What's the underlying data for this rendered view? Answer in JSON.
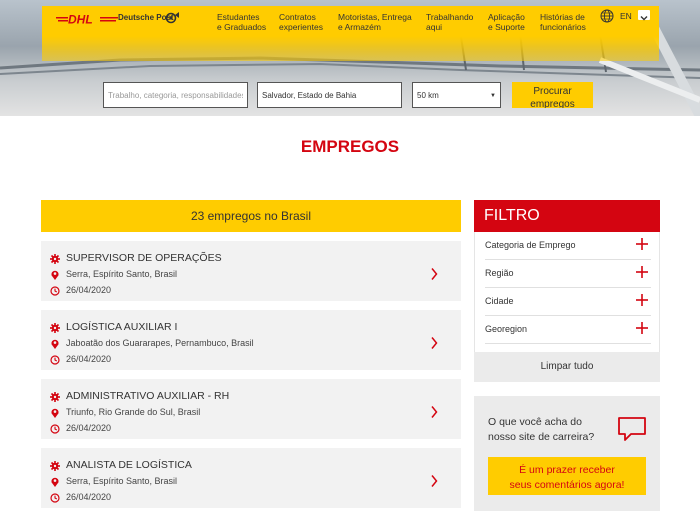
{
  "brand": {
    "logo_text": "DHL",
    "partner": "Deutsche Post"
  },
  "nav": {
    "items": [
      {
        "lines": [
          "Estudantes",
          "e Graduados"
        ]
      },
      {
        "lines": [
          "Contratos",
          "experientes"
        ]
      },
      {
        "lines": [
          "Motoristas, Entrega",
          "e Armazém"
        ]
      },
      {
        "lines": [
          "Trabalhando",
          "aqui"
        ]
      },
      {
        "lines": [
          "Aplicação",
          "e Suporte"
        ]
      },
      {
        "lines": [
          "Histórias de",
          "funcionários"
        ]
      }
    ],
    "language": "EN"
  },
  "search": {
    "keyword_placeholder": "Trabalho, categoria, responsabilidades",
    "location_value": "Salvador, Estado de Bahia",
    "radius": "50 km",
    "button_label": "Procurar empregos"
  },
  "page": {
    "title": "EMPREGOS"
  },
  "results": {
    "summary": "23 empregos no Brasil",
    "jobs": [
      {
        "title": "SUPERVISOR DE OPERAÇÕES",
        "location": "Serra, Espírito Santo, Brasil",
        "date": "26/04/2020"
      },
      {
        "title": "LOGÍSTICA AUXILIAR I",
        "location": "Jaboatão dos Guararapes, Pernambuco, Brasil",
        "date": "26/04/2020"
      },
      {
        "title": "ADMINISTRATIVO AUXILIAR - RH",
        "location": "Triunfo, Rio Grande do Sul, Brasil",
        "date": "26/04/2020"
      },
      {
        "title": "ANALISTA DE LOGÍSTICA",
        "location": "Serra, Espírito Santo, Brasil",
        "date": "26/04/2020"
      }
    ]
  },
  "filter": {
    "title": "FILTRO",
    "items": [
      {
        "label": "Categoria de Emprego"
      },
      {
        "label": "Região"
      },
      {
        "label": "Cidade"
      },
      {
        "label": "Georegion"
      }
    ],
    "clear_label": "Limpar tudo"
  },
  "feedback": {
    "question_lines": [
      "O que você acha do",
      "nosso site de carreira?"
    ],
    "button_lines": [
      "É um prazer receber",
      "seus comentários agora!"
    ]
  },
  "colors": {
    "dhl_yellow": "#ffcc00",
    "dhl_red": "#d40511"
  }
}
